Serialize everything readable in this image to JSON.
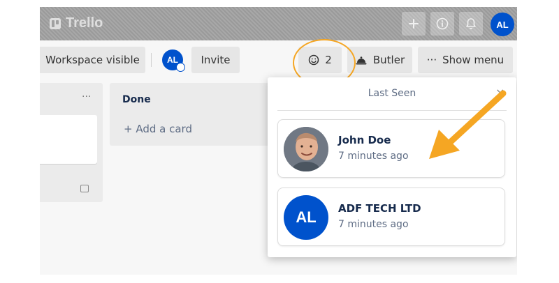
{
  "header": {
    "brand": "Trello",
    "buttons": [
      "plus-icon",
      "info-icon",
      "bell-icon"
    ],
    "avatar_initials": "AL"
  },
  "board_bar": {
    "visibility_label": "Workspace visible",
    "member_initials": "AL",
    "invite_label": "Invite",
    "activity_count": "2",
    "butler_label": "Butler",
    "show_menu_label": "Show menu"
  },
  "lists": [
    {
      "title": "",
      "menu": "···"
    },
    {
      "title": "Done",
      "add_card": "+ Add a card"
    }
  ],
  "popover": {
    "title": "Last Seen",
    "close": "×",
    "people": [
      {
        "name": "John Doe",
        "time": "7 minutes ago",
        "avatar": "photo"
      },
      {
        "name": "ADF TECH LTD",
        "time": "7 minutes ago",
        "avatar": "AL"
      }
    ]
  },
  "colors": {
    "brand_blue": "#0052cc",
    "annotation_orange": "#f5a623"
  }
}
